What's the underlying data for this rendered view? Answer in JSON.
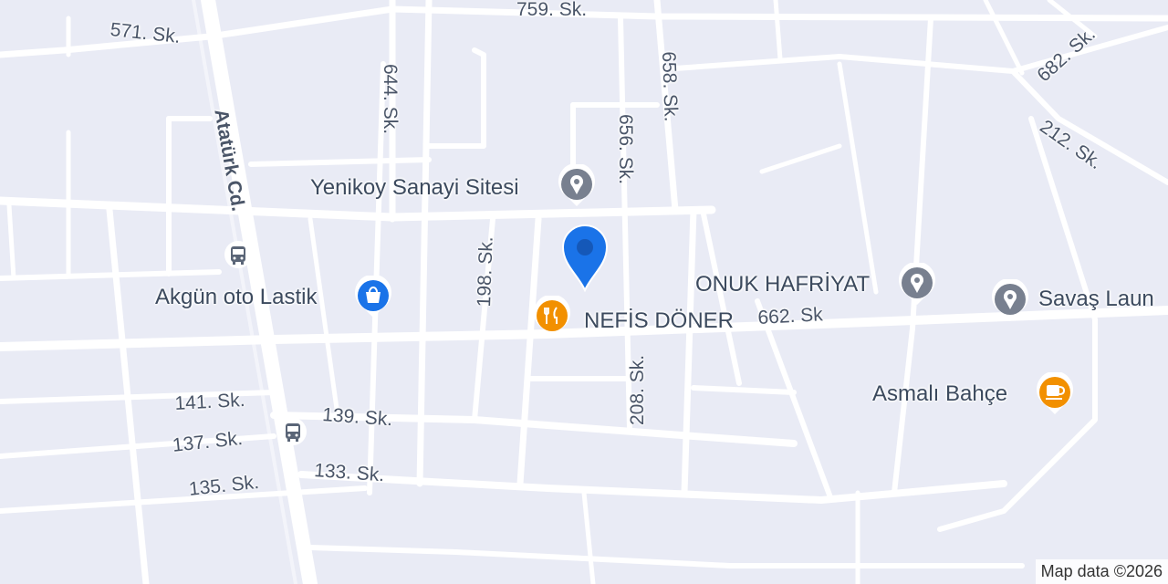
{
  "streets": {
    "s759": "759. Sk.",
    "s571": "571. Sk.",
    "s682": "682. Sk.",
    "s644": "644. Sk.",
    "s658": "658. Sk.",
    "s656": "656. Sk.",
    "s212": "212. Sk.",
    "ataturk": "Atatürk Cd.",
    "s198": "198. Sk.",
    "s662": "662. Sk",
    "s208": "208. Sk.",
    "s141": "141. Sk.",
    "s139": "139. Sk.",
    "s137": "137. Sk.",
    "s133": "133. Sk.",
    "s135": "135. Sk."
  },
  "pois": {
    "yenikoy": "Yenikoy Sanayi Sitesi",
    "akgun": "Akgün oto Lastik",
    "nefis": "NEFİS DÖNER",
    "onuk": "ONUK HAFRİYAT",
    "savas": "Savaş Laun",
    "asmali": "Asmalı Bahçe"
  },
  "icons": {
    "location_pin": "location-pin-icon",
    "generic_poi": "place-marker-icon",
    "shopping": "shopping-bag-icon",
    "restaurant": "restaurant-icon",
    "cafe": "coffee-cup-icon",
    "bus": "bus-stop-icon"
  },
  "colors": {
    "map_background": "#e9ebf5",
    "road": "#ffffff",
    "poi_gray": "#78808f",
    "poi_blue": "#1a73e8",
    "poi_orange": "#f29000",
    "pin_blue": "#1a73e8"
  },
  "attribution": "Map data ©2026"
}
